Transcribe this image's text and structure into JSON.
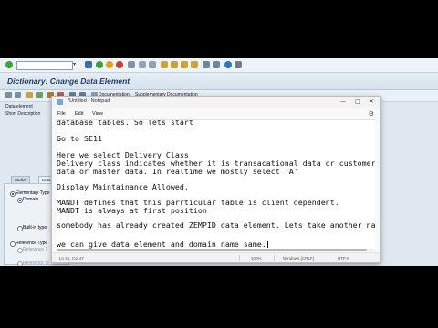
{
  "sap": {
    "command_field_value": "",
    "title": "Dictionary: Change Data Element",
    "app_toolbar": {
      "documentation": "Documentation",
      "supplementary": "Supplementary Documentation"
    },
    "left": {
      "data_element": "Data element",
      "short_description": "Short Description",
      "tabs": [
        "Attribs",
        "Data"
      ],
      "elementary_type": "Elementary Type",
      "domain": "Domain",
      "built_in_type": "Built-in type",
      "reference_type": "Reference Type",
      "reference_to_1": "Reference T",
      "reference_to_2": "Reference to"
    }
  },
  "notepad": {
    "title": "*Untitled - Notepad",
    "controls": {
      "minimize": "—",
      "maximize": "□",
      "close": "✕"
    },
    "menu": [
      "File",
      "Edit",
      "View"
    ],
    "lines": [
      "database tables. So lets start",
      "",
      "Go to SE11",
      "",
      "Here we select Delivery Class",
      "Delivery class indicates whether it is transacational data or customer",
      "data or master data. In realtime we mostly select 'A'",
      "",
      "Display Maintainance Allowed.",
      "",
      "MANDT defines that this parrticular table is client dependent.",
      "MANDT is always at first position",
      "",
      "somebody has already created ZEMPID data element. Lets take another name",
      "",
      "we can give data element and domain name same."
    ],
    "status": {
      "position": "Ln 25, Col 47",
      "zoom": "100%",
      "line_ending": "Windows (CRLF)",
      "encoding": "UTF-8"
    }
  },
  "colors": {
    "sap_title": "#1f3e63",
    "sap_background": "#dfe8f1",
    "notepad_background": "#ffffff"
  }
}
